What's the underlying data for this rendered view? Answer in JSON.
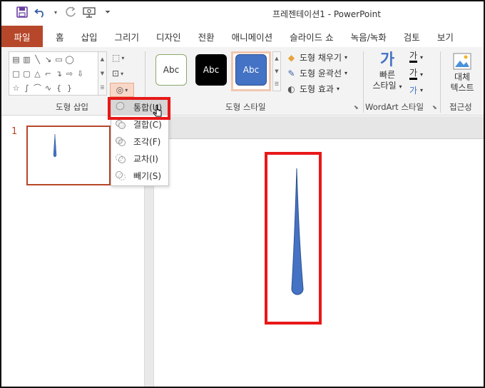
{
  "app": {
    "title": "프레젠테이션1  -  PowerPoint"
  },
  "quick_access": {
    "icons": [
      "save-icon",
      "undo-icon",
      "redo-icon",
      "present-icon",
      "customize-icon"
    ]
  },
  "tabs": [
    {
      "label": "파일"
    },
    {
      "label": "홈"
    },
    {
      "label": "삽입"
    },
    {
      "label": "그리기"
    },
    {
      "label": "디자인"
    },
    {
      "label": "전환"
    },
    {
      "label": "애니메이션"
    },
    {
      "label": "슬라이드 쇼"
    },
    {
      "label": "녹음/녹화"
    },
    {
      "label": "검토"
    },
    {
      "label": "보기"
    }
  ],
  "ribbon": {
    "insert_shapes": {
      "label": "도형 삽입"
    },
    "shape_styles": {
      "label": "도형 스타일",
      "presets": [
        "Abc",
        "Abc",
        "Abc"
      ],
      "fill": "도형 채우기",
      "outline": "도형 윤곽선",
      "effects": "도형 효과"
    },
    "wordart": {
      "label": "WordArt 스타일",
      "quick_styles_line1": "빠른",
      "quick_styles_line2": "스타일",
      "glyph": "가"
    },
    "accessibility": {
      "label": "접근성",
      "alt_text_line1": "대체",
      "alt_text_line2": "텍스트"
    }
  },
  "merge_menu": {
    "items": [
      {
        "label": "통합(U)",
        "icon": "union-icon"
      },
      {
        "label": "결합(C)",
        "icon": "combine-icon"
      },
      {
        "label": "조각(F)",
        "icon": "fragment-icon"
      },
      {
        "label": "교차(I)",
        "icon": "intersect-icon"
      },
      {
        "label": "빼기(S)",
        "icon": "subtract-icon"
      }
    ]
  },
  "slides": {
    "number": "1"
  },
  "colors": {
    "accent": "#b7472a",
    "shape_fill": "#4472c4",
    "shape_outline": "#2f528f",
    "highlight": "#e81818",
    "menu_hover": "#d6d6d6"
  }
}
